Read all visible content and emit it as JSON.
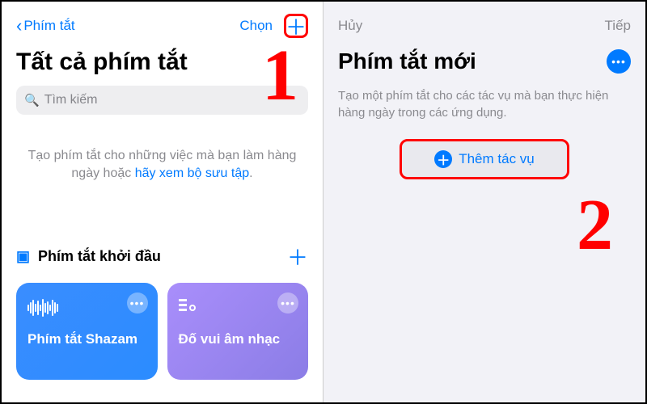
{
  "left": {
    "nav_back": "Phím tắt",
    "nav_select": "Chọn",
    "title": "Tất cả phím tắt",
    "search_placeholder": "Tìm kiếm",
    "hint_prefix": "Tạo phím tắt cho những việc mà bạn làm hàng ngày hoặc ",
    "hint_link": "hãy xem bộ sưu tập",
    "hint_suffix": ".",
    "collection_title": "Phím tắt khởi đầu",
    "cards": [
      {
        "label": "Phím tắt Shazam"
      },
      {
        "label": "Đố vui âm nhạc"
      }
    ]
  },
  "right": {
    "nav_cancel": "Hủy",
    "nav_next": "Tiếp",
    "title": "Phím tắt mới",
    "desc": "Tạo một phím tắt cho các tác vụ mà bạn thực hiện hàng ngày trong các ứng dụng.",
    "add_action": "Thêm tác vụ"
  },
  "annotations": {
    "one": "1",
    "two": "2"
  }
}
